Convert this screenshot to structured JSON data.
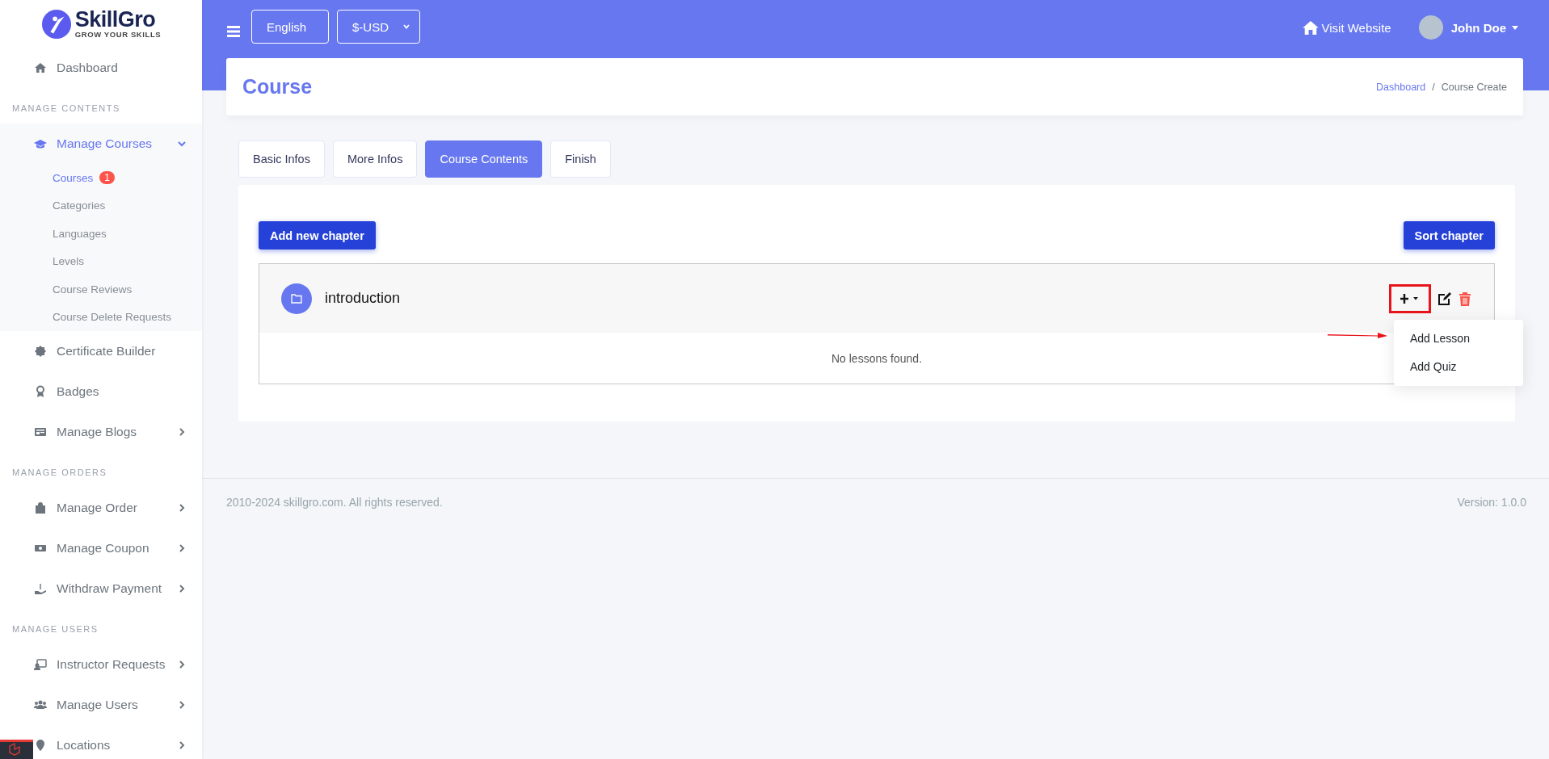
{
  "brand": {
    "name": "SkillGro",
    "tagline": "GROW YOUR SKILLS"
  },
  "sidebar": {
    "items": [
      {
        "kind": "link",
        "label": "Dashboard",
        "selected": false
      },
      {
        "kind": "section",
        "label": "MANAGE CONTENTS"
      },
      {
        "kind": "group",
        "label": "Manage Courses",
        "selected": true,
        "expanded": true,
        "children": [
          {
            "label": "Courses",
            "selected": true,
            "badge": "1"
          },
          {
            "label": "Categories",
            "selected": false
          },
          {
            "label": "Languages",
            "selected": false
          },
          {
            "label": "Levels",
            "selected": false
          },
          {
            "label": "Course Reviews",
            "selected": false
          },
          {
            "label": "Course Delete Requests",
            "selected": false
          }
        ]
      },
      {
        "kind": "link",
        "label": "Certificate Builder",
        "selected": false
      },
      {
        "kind": "link",
        "label": "Badges",
        "selected": false
      },
      {
        "kind": "group",
        "label": "Manage Blogs",
        "selected": false,
        "expanded": false
      },
      {
        "kind": "section",
        "label": "MANAGE ORDERS"
      },
      {
        "kind": "group",
        "label": "Manage Order",
        "selected": false,
        "expanded": false
      },
      {
        "kind": "group",
        "label": "Manage Coupon",
        "selected": false,
        "expanded": false
      },
      {
        "kind": "group",
        "label": "Withdraw Payment",
        "selected": false,
        "expanded": false
      },
      {
        "kind": "section",
        "label": "MANAGE USERS"
      },
      {
        "kind": "group",
        "label": "Instructor Requests",
        "selected": false,
        "expanded": false
      },
      {
        "kind": "group",
        "label": "Manage Users",
        "selected": false,
        "expanded": false
      },
      {
        "kind": "group",
        "label": "Locations",
        "selected": false,
        "expanded": false
      }
    ]
  },
  "topbar": {
    "language": "English",
    "currency": "$-USD",
    "visit_website": "Visit Website",
    "user_name": "John Doe"
  },
  "page": {
    "title": "Course",
    "breadcrumb_separator": "/",
    "breadcrumb": [
      {
        "label": "Dashboard",
        "kind": "link"
      },
      {
        "label": "Course Create",
        "kind": "current"
      }
    ]
  },
  "tabs": [
    {
      "label": "Basic Infos",
      "selected": false
    },
    {
      "label": "More Infos",
      "selected": false
    },
    {
      "label": "Course Contents",
      "selected": true
    },
    {
      "label": "Finish",
      "selected": false
    }
  ],
  "actions": {
    "add_chapter": "Add new chapter",
    "sort_chapter": "Sort chapter"
  },
  "chapters": [
    {
      "title": "introduction",
      "empty_text": "No lessons found.",
      "menu_open": true,
      "menu": [
        "Add Lesson",
        "Add Quiz"
      ]
    }
  ],
  "footer": {
    "copyright": "2010-2024 skillgro.com. All rights reserved.",
    "version": "Version: 1.0.0"
  }
}
